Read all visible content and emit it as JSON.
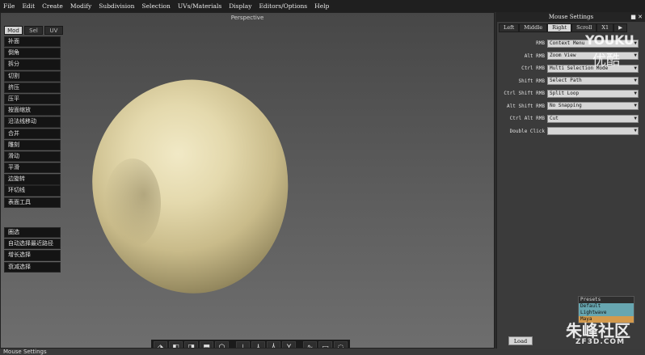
{
  "menubar": [
    "File",
    "Edit",
    "Create",
    "Modify",
    "Subdivision",
    "Selection",
    "UVs/Materials",
    "Display",
    "Editors/Options",
    "Help"
  ],
  "viewport": {
    "title": "Perspective"
  },
  "panel_tabs": [
    {
      "label": "Mod",
      "active": true
    },
    {
      "label": "Sel",
      "active": false
    },
    {
      "label": "UV",
      "active": false
    }
  ],
  "tools": [
    "补面",
    "倒角",
    "拆分",
    "切割",
    "挤压",
    "压平",
    "按面缩放",
    "沿法线移动",
    "合并",
    "雕刻",
    "滑动",
    "平滑",
    "边旋转",
    "环切线",
    "表面工具"
  ],
  "tools2": [
    "圈选",
    "自动选择最近路径",
    "增长选择",
    "衰减选择"
  ],
  "shelf": [
    "cube-icon",
    "cube-front-icon",
    "cube-side-icon",
    "cube-top-icon",
    "sphere-icon",
    "axis-x-icon",
    "axis-y-icon",
    "axis-z-icon",
    "axis-all-icon",
    "curve-icon",
    "rect-select-icon",
    "lasso-icon"
  ],
  "mouse_settings": {
    "title": "Mouse Settings",
    "tabs": [
      {
        "label": "Left",
        "active": false
      },
      {
        "label": "Middle",
        "active": false
      },
      {
        "label": "Right",
        "active": true
      },
      {
        "label": "Scroll",
        "active": false
      },
      {
        "label": "X1",
        "active": false
      }
    ],
    "rows": [
      {
        "label": "RMB",
        "value": "Context Menu"
      },
      {
        "label": "Alt RMB",
        "value": "Zoom View"
      },
      {
        "label": "Ctrl RMB",
        "value": "Multi Selection Mode"
      },
      {
        "label": "Shift RMB",
        "value": "Select Path"
      },
      {
        "label": "Ctrl Shift RMB",
        "value": "Split Loop"
      },
      {
        "label": "Alt Shift RMB",
        "value": "No Snapping"
      },
      {
        "label": "Ctrl Alt RMB",
        "value": "Cut"
      },
      {
        "label": "Double Click",
        "value": ""
      }
    ],
    "presets": [
      "Presets",
      "Default",
      "Lightwave",
      "Maya"
    ],
    "load_label": "Load"
  },
  "status": "Mouse Settings",
  "watermarks": {
    "youku": "YOUKU",
    "youku_cn": "优酷",
    "site": "朱峰社区",
    "site_url": "ZF3D.COM"
  }
}
